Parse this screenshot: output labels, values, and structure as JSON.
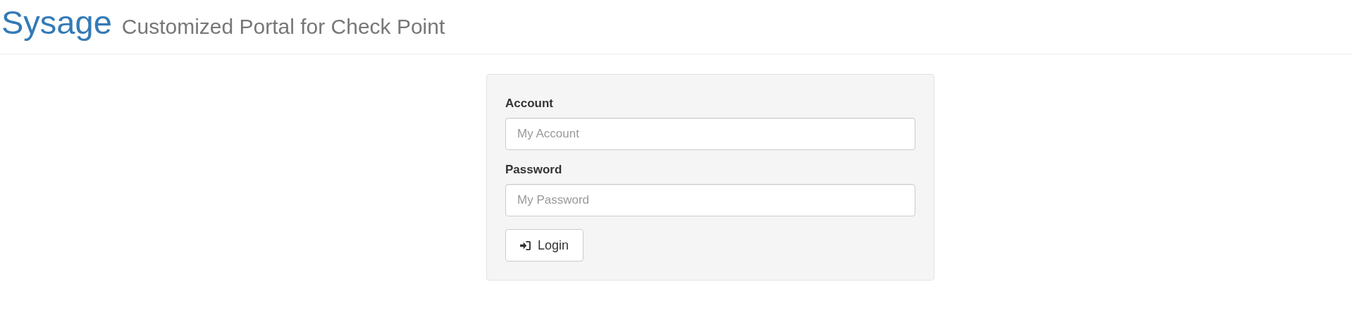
{
  "header": {
    "brand": "Sysage",
    "subtitle": "Customized Portal for Check Point"
  },
  "form": {
    "fields": [
      {
        "label": "Account",
        "placeholder": "My Account"
      },
      {
        "label": "Password",
        "placeholder": "My Password"
      }
    ],
    "button": "Login"
  }
}
